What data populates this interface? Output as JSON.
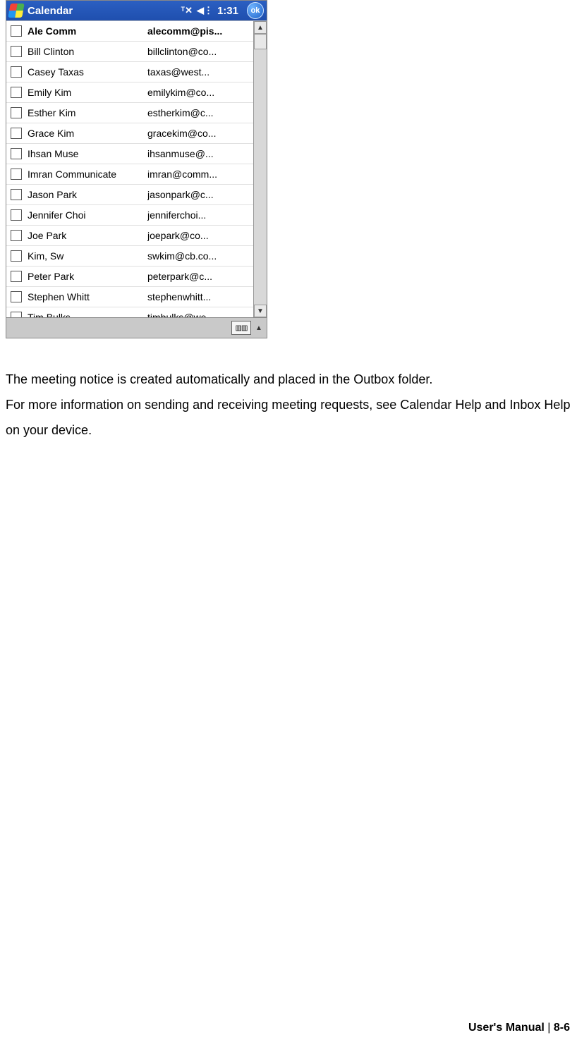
{
  "titlebar": {
    "app_title": "Calendar",
    "clock": "1:31",
    "ok_label": "ok"
  },
  "contacts": [
    {
      "name": "Ale Comm",
      "email": "alecomm@pis...",
      "selected": true
    },
    {
      "name": "Bill Clinton",
      "email": "billclinton@co...",
      "selected": false
    },
    {
      "name": "Casey Taxas",
      "email": "taxas@west...",
      "selected": false
    },
    {
      "name": "Emily Kim",
      "email": "emilykim@co...",
      "selected": false
    },
    {
      "name": "Esther Kim",
      "email": "estherkim@c...",
      "selected": false
    },
    {
      "name": "Grace Kim",
      "email": "gracekim@co...",
      "selected": false
    },
    {
      "name": "Ihsan Muse",
      "email": "ihsanmuse@...",
      "selected": false
    },
    {
      "name": "Imran Communicate",
      "email": "imran@comm...",
      "selected": false
    },
    {
      "name": "Jason Park",
      "email": "jasonpark@c...",
      "selected": false
    },
    {
      "name": "Jennifer Choi",
      "email": "jenniferchoi...",
      "selected": false
    },
    {
      "name": "Joe Park",
      "email": "joepark@co...",
      "selected": false
    },
    {
      "name": "Kim, Sw",
      "email": "swkim@cb.co...",
      "selected": false
    },
    {
      "name": "Peter Park",
      "email": "peterpark@c...",
      "selected": false
    },
    {
      "name": "Stephen Whitt",
      "email": "stephenwhitt...",
      "selected": false
    },
    {
      "name": "Tim Bulks",
      "email": "timbulks@we...",
      "selected": false
    }
  ],
  "doc": {
    "line1": "The meeting notice is created automatically and placed in the Outbox folder.",
    "line2": "For more information on sending and receiving meeting requests, see Calendar Help and Inbox Help on your device."
  },
  "footer": {
    "manual": "User's Manual",
    "separator": "|",
    "page": "8-6"
  }
}
